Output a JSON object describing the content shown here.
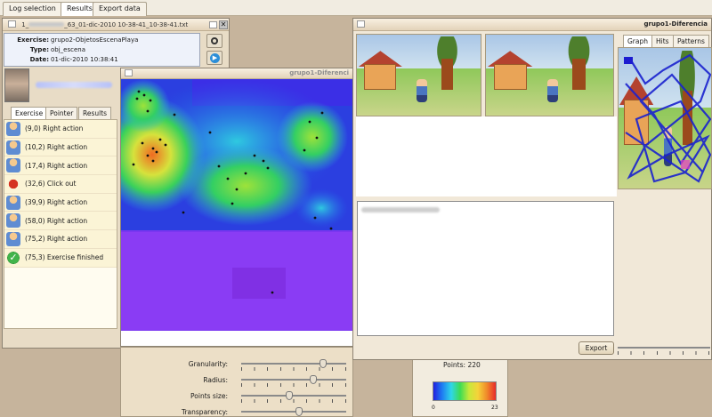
{
  "top_tabs": [
    {
      "label": "Log selection",
      "active": false
    },
    {
      "label": "Results",
      "active": true
    },
    {
      "label": "Export data",
      "active": false
    }
  ],
  "log_window": {
    "title": "1_",
    "title_tail": "_63_01-dic-2010 10-38-41_10-38-41.txt",
    "exercise_label": "Exercise:",
    "exercise": "grupo2-ObjetosEscenaPlaya",
    "type_label": "Type:",
    "type": "obj_escena",
    "date_label": "Date:",
    "date": "01-dic-2010 10:38:41"
  },
  "sub_tabs": [
    {
      "label": "Exercise",
      "active": true
    },
    {
      "label": "Pointer",
      "active": false
    },
    {
      "label": "Results",
      "active": false
    }
  ],
  "events": [
    {
      "text": "(9,0) Right action",
      "icon": "person-icon"
    },
    {
      "text": "(10,2) Right action",
      "icon": "person-icon"
    },
    {
      "text": "(17,4) Right action",
      "icon": "person-icon"
    },
    {
      "text": "(32,6) Click out",
      "icon": "crab-icon"
    },
    {
      "text": "(39,9) Right action",
      "icon": "person-icon"
    },
    {
      "text": "(58,0) Right action",
      "icon": "person-icon"
    },
    {
      "text": "(75,2) Right action",
      "icon": "person-icon"
    },
    {
      "text": "(75,3) Exercise finished",
      "icon": "check-icon"
    }
  ],
  "heatmap_window": {
    "title": "grupo1-Diferenci"
  },
  "controls": {
    "granularity_label": "Granularity:",
    "radius_label": "Radius:",
    "points_size_label": "Points size:",
    "transparency_label": "Transparency:",
    "granularity": 0.8,
    "radius": 0.7,
    "points_size": 0.45,
    "transparency": 0.55
  },
  "points_box": {
    "label": "Points: 220",
    "min": "0",
    "max": "23"
  },
  "diff_window": {
    "title": "grupo1-Diferencia",
    "export_label": "Export"
  },
  "graph_tabs": [
    {
      "label": "Graph",
      "active": true
    },
    {
      "label": "Hits",
      "active": false
    },
    {
      "label": "Patterns",
      "active": false
    }
  ],
  "colors": {
    "accent": "#2f3ad0",
    "heat_low": "#7b2ff0",
    "heat_high": "#e83a2a"
  }
}
